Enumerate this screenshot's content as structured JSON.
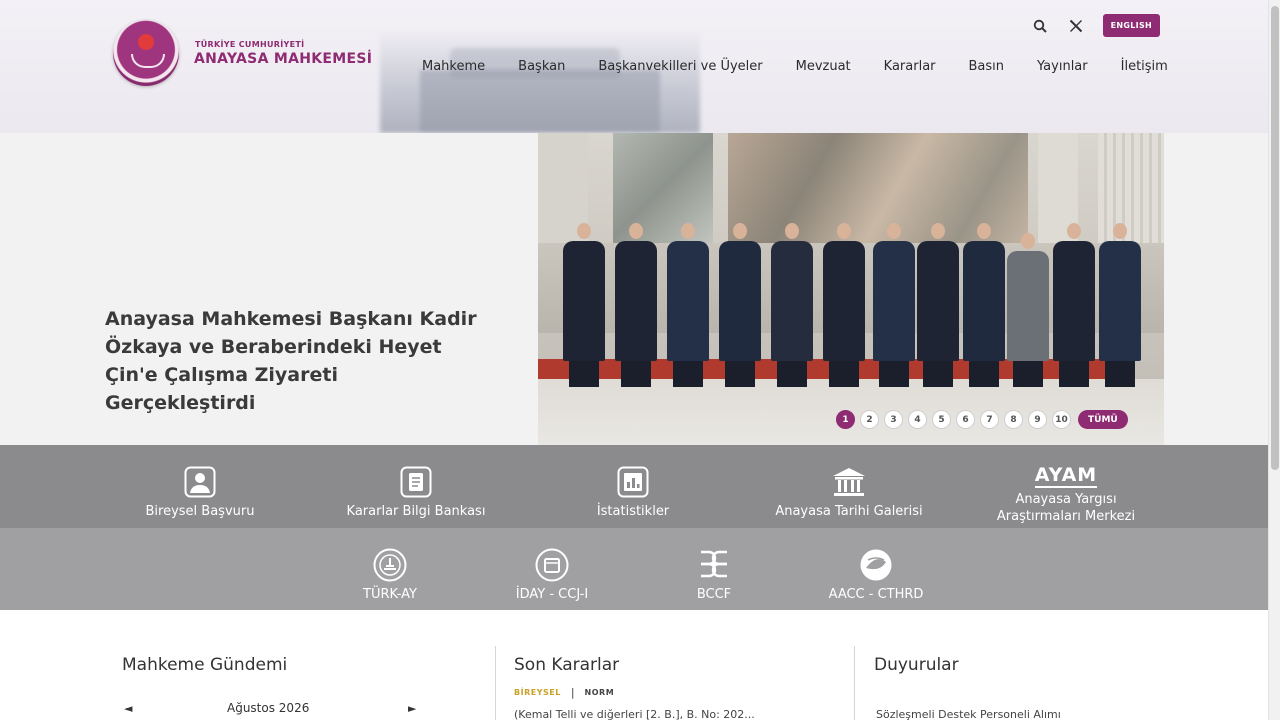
{
  "header": {
    "org_top": "TÜRKİYE CUMHURİYETİ",
    "org_main": "ANAYASA MAHKEMESİ",
    "lang_button": "ENGLISH",
    "nav": [
      "Mahkeme",
      "Başkan",
      "Başkanvekilleri ve Üyeler",
      "Mevzuat",
      "Kararlar",
      "Basın",
      "Yayınlar",
      "İletişim"
    ]
  },
  "hero": {
    "title": "Anayasa Mahkemesi Başkanı Kadir Özkaya ve Beraberindeki Heyet Çin'e Çalışma Ziyareti Gerçekleştirdi",
    "slides": [
      "1",
      "2",
      "3",
      "4",
      "5",
      "6",
      "7",
      "8",
      "9",
      "10"
    ],
    "active_slide": "1",
    "all_label": "TÜMÜ"
  },
  "quick_links": {
    "row1": [
      {
        "label": "Bireysel Başvuru",
        "icon": "user-badge-icon"
      },
      {
        "label": "Kararlar Bilgi Bankası",
        "icon": "document-icon"
      },
      {
        "label": "İstatistikler",
        "icon": "bar-chart-icon"
      },
      {
        "label": "Anayasa Tarihi Galerisi",
        "icon": "courthouse-icon"
      },
      {
        "label": "Anayasa Yargısı Araştırmaları Merkezi",
        "logo_text": "AYAM"
      }
    ],
    "row2": [
      {
        "label": "TÜRK-AY",
        "icon": "turk-ay-emblem-icon"
      },
      {
        "label": "İDAY - CCJ-I",
        "icon": "iday-emblem-icon"
      },
      {
        "label": "BCCF",
        "icon": "bccf-emblem-icon"
      },
      {
        "label": "AACC - CTHRD",
        "icon": "aacc-emblem-icon"
      }
    ]
  },
  "agenda": {
    "title": "Mahkeme Gündemi",
    "month": "Ağustos 2026",
    "prev": "◄",
    "next": "►"
  },
  "decisions": {
    "title": "Son Kararlar",
    "tag_a": "BİREYSEL",
    "separator": "|",
    "tag_b": "NORM",
    "first_item": "(Kemal Telli ve diğerleri [2. B.], B. No: 202..."
  },
  "announcements": {
    "title": "Duyurular",
    "first_item": "Sözleşmeli Destek Personeli Alımı"
  }
}
